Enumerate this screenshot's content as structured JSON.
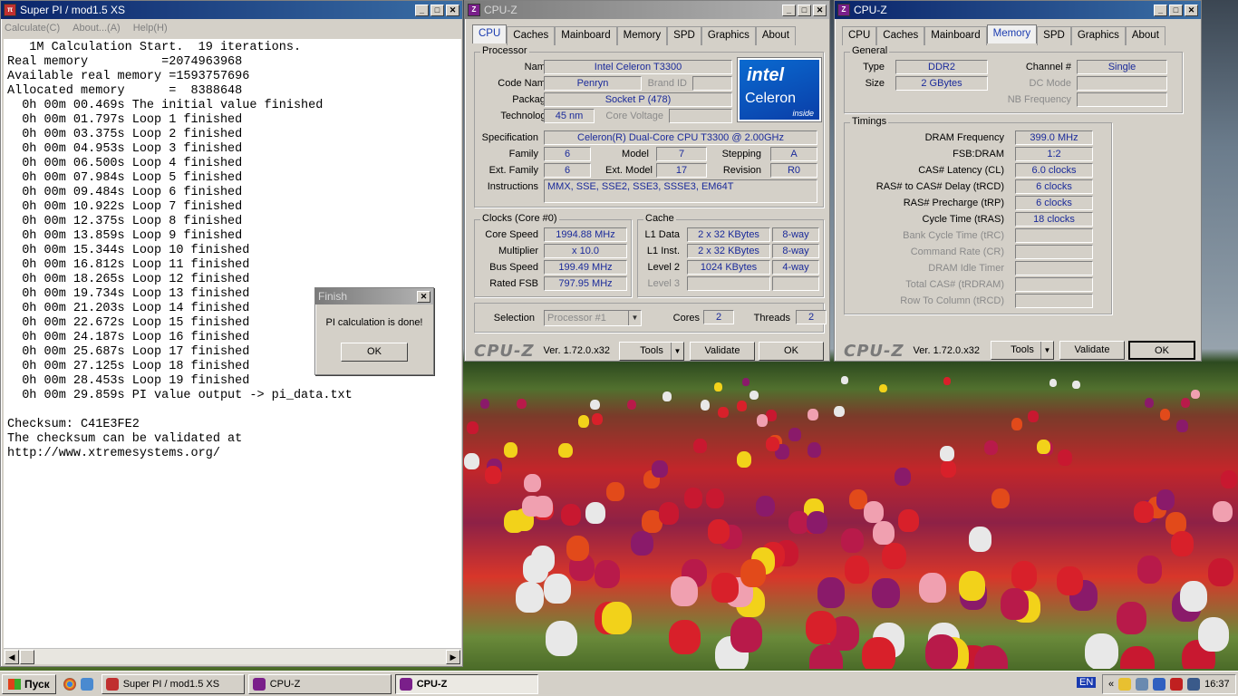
{
  "superpi": {
    "title": "Super PI / mod1.5 XS",
    "menu": [
      "Calculate(C)",
      "About...(A)",
      "Help(H)"
    ],
    "lines": [
      "   1M Calculation Start.  19 iterations.",
      "Real memory          =2074963968",
      "Available real memory =1593757696",
      "Allocated memory      =  8388648",
      "  0h 00m 00.469s The initial value finished",
      "  0h 00m 01.797s Loop 1 finished",
      "  0h 00m 03.375s Loop 2 finished",
      "  0h 00m 04.953s Loop 3 finished",
      "  0h 00m 06.500s Loop 4 finished",
      "  0h 00m 07.984s Loop 5 finished",
      "  0h 00m 09.484s Loop 6 finished",
      "  0h 00m 10.922s Loop 7 finished",
      "  0h 00m 12.375s Loop 8 finished",
      "  0h 00m 13.859s Loop 9 finished",
      "  0h 00m 15.344s Loop 10 finished",
      "  0h 00m 16.812s Loop 11 finished",
      "  0h 00m 18.265s Loop 12 finished",
      "  0h 00m 19.734s Loop 13 finished",
      "  0h 00m 21.203s Loop 14 finished",
      "  0h 00m 22.672s Loop 15 finished",
      "  0h 00m 24.187s Loop 16 finished",
      "  0h 00m 25.687s Loop 17 finished",
      "  0h 00m 27.125s Loop 18 finished",
      "  0h 00m 28.453s Loop 19 finished",
      "  0h 00m 29.859s PI value output -> pi_data.txt",
      "",
      "Checksum: C41E3FE2",
      "The checksum can be validated at",
      "http://www.xtremesystems.org/"
    ]
  },
  "finish_dialog": {
    "title": "Finish",
    "message": "PI calculation is done!",
    "ok": "OK"
  },
  "cpuz1": {
    "title": "CPU-Z",
    "tabs": [
      "CPU",
      "Caches",
      "Mainboard",
      "Memory",
      "SPD",
      "Graphics",
      "About"
    ],
    "processor_group": "Processor",
    "name_label": "Name",
    "name": "Intel Celeron T3300",
    "codename_label": "Code Name",
    "codename": "Penryn",
    "brandid_label": "Brand ID",
    "package_label": "Package",
    "package": "Socket P (478)",
    "technology_label": "Technology",
    "technology": "45 nm",
    "corevoltage_label": "Core Voltage",
    "spec_label": "Specification",
    "spec": "Celeron(R) Dual-Core CPU    T3300  @ 2.00GHz",
    "family_label": "Family",
    "family": "6",
    "model_label": "Model",
    "model": "7",
    "stepping_label": "Stepping",
    "stepping": "A",
    "extfamily_label": "Ext. Family",
    "extfamily": "6",
    "extmodel_label": "Ext. Model",
    "extmodel": "17",
    "revision_label": "Revision",
    "revision": "R0",
    "instr_label": "Instructions",
    "instr": "MMX, SSE, SSE2, SSE3, SSSE3, EM64T",
    "clocks_group": "Clocks (Core #0)",
    "corespeed_label": "Core Speed",
    "corespeed": "1994.88 MHz",
    "multiplier_label": "Multiplier",
    "multiplier": "x 10.0",
    "busspeed_label": "Bus Speed",
    "busspeed": "199.49 MHz",
    "ratedfsb_label": "Rated FSB",
    "ratedfsb": "797.95 MHz",
    "cache_group": "Cache",
    "l1d_label": "L1 Data",
    "l1d": "2 x 32 KBytes",
    "l1d_way": "8-way",
    "l1i_label": "L1 Inst.",
    "l1i": "2 x 32 KBytes",
    "l1i_way": "8-way",
    "l2_label": "Level 2",
    "l2": "1024 KBytes",
    "l2_way": "4-way",
    "l3_label": "Level 3",
    "selection_label": "Selection",
    "selection": "Processor #1",
    "cores_label": "Cores",
    "cores": "2",
    "threads_label": "Threads",
    "threads": "2",
    "logo_brand": "intel",
    "logo_product": "Celeron",
    "logo_inside": "inside"
  },
  "cpuz2": {
    "title": "CPU-Z",
    "tabs": [
      "CPU",
      "Caches",
      "Mainboard",
      "Memory",
      "SPD",
      "Graphics",
      "About"
    ],
    "general_group": "General",
    "type_label": "Type",
    "type": "DDR2",
    "size_label": "Size",
    "size": "2 GBytes",
    "channel_label": "Channel #",
    "channel": "Single",
    "dcmode_label": "DC Mode",
    "nbfreq_label": "NB Frequency",
    "timings_group": "Timings",
    "rows": [
      {
        "label": "DRAM Frequency",
        "value": "399.0 MHz",
        "dim": false
      },
      {
        "label": "FSB:DRAM",
        "value": "1:2",
        "dim": false
      },
      {
        "label": "CAS# Latency (CL)",
        "value": "6.0 clocks",
        "dim": false
      },
      {
        "label": "RAS# to CAS# Delay (tRCD)",
        "value": "6 clocks",
        "dim": false
      },
      {
        "label": "RAS# Precharge (tRP)",
        "value": "6 clocks",
        "dim": false
      },
      {
        "label": "Cycle Time (tRAS)",
        "value": "18 clocks",
        "dim": false
      },
      {
        "label": "Bank Cycle Time (tRC)",
        "value": "",
        "dim": true
      },
      {
        "label": "Command Rate (CR)",
        "value": "",
        "dim": true
      },
      {
        "label": "DRAM Idle Timer",
        "value": "",
        "dim": true
      },
      {
        "label": "Total CAS# (tRDRAM)",
        "value": "",
        "dim": true
      },
      {
        "label": "Row To Column (tRCD)",
        "value": "",
        "dim": true
      }
    ]
  },
  "footer": {
    "brand": "CPU-Z",
    "version": "Ver. 1.72.0.x32",
    "tools": "Tools",
    "validate": "Validate",
    "ok": "OK"
  },
  "taskbar": {
    "start": "Пуск",
    "tasks": [
      "Super PI / mod1.5 XS",
      "CPU-Z",
      "CPU-Z"
    ],
    "lang": "EN",
    "clock": "16:37"
  }
}
